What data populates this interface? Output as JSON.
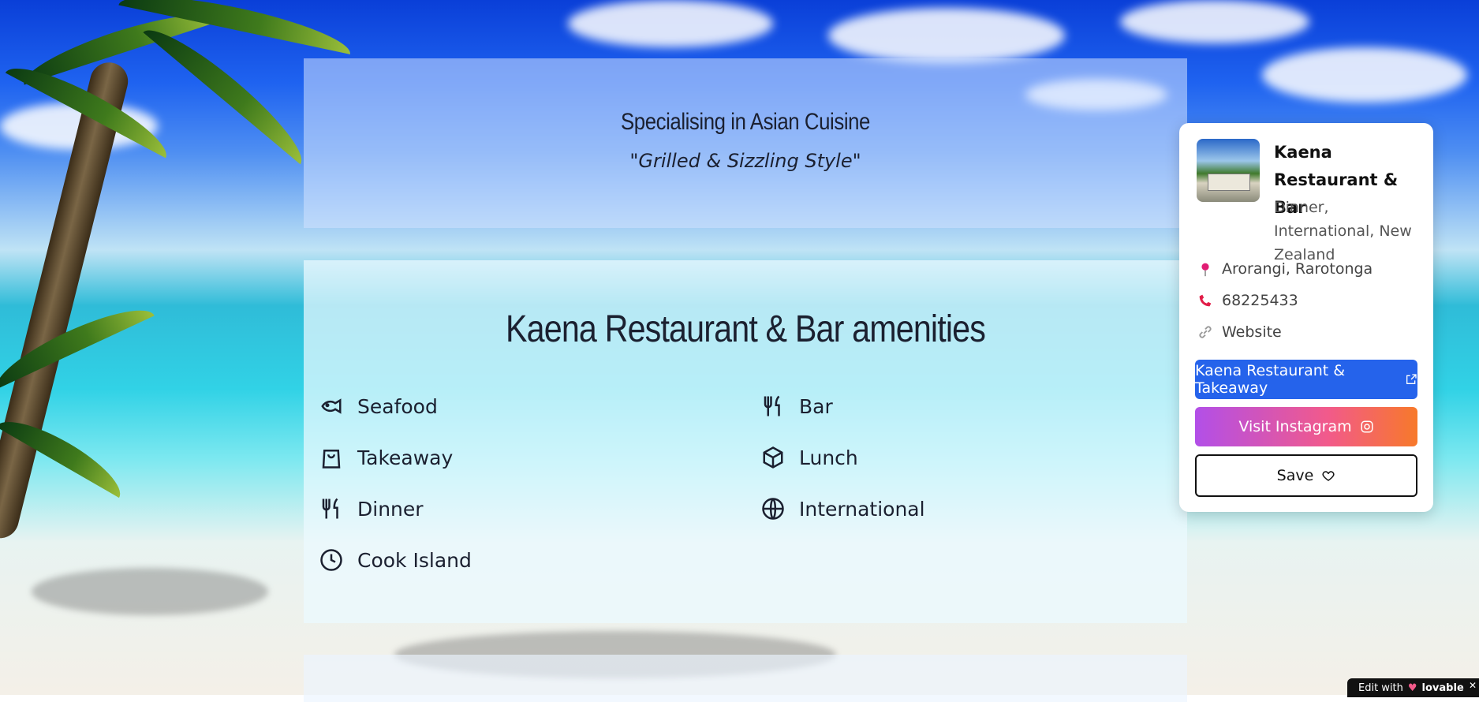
{
  "header": {
    "specialty": "Specialising in Asian Cuisine",
    "tagline": "\"Grilled & Sizzling Style\""
  },
  "amenities": {
    "title": "Kaena Restaurant & Bar amenities",
    "items": [
      {
        "label": "Seafood",
        "icon": "fish-icon"
      },
      {
        "label": "Bar",
        "icon": "utensils-icon"
      },
      {
        "label": "Takeaway",
        "icon": "shopping-bag-icon"
      },
      {
        "label": "Lunch",
        "icon": "box-icon"
      },
      {
        "label": "Dinner",
        "icon": "utensils-icon"
      },
      {
        "label": "International",
        "icon": "globe-icon"
      },
      {
        "label": "Cook Island",
        "icon": "clock-icon"
      }
    ]
  },
  "card": {
    "name": "Kaena Restaurant & Bar",
    "categories": "Dinner, International, New Zealand",
    "location": "Arorangi, Rarotonga",
    "phone": "68225433",
    "website": "Website",
    "primary_button": "Kaena Restaurant & Takeaway",
    "instagram_button": "Visit Instagram",
    "save_button": "Save"
  },
  "badge": {
    "text": "Edit with",
    "brand": "lovable"
  },
  "colors": {
    "primary_blue": "#2563eb",
    "instagram_start": "#b24fe8",
    "instagram_end": "#f7792a",
    "pin_pink": "#e11d74",
    "phone_red": "#e11d48"
  }
}
